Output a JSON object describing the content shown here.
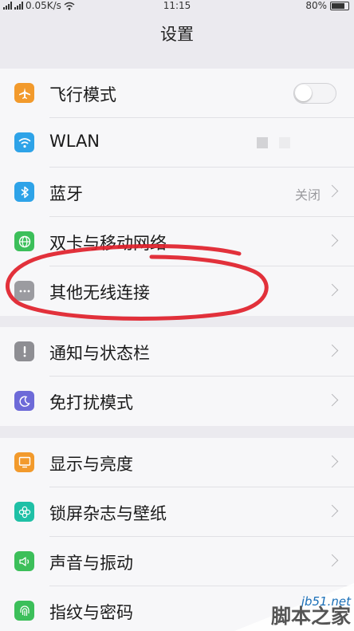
{
  "status_bar": {
    "network_speed": "0.05K/s",
    "time": "11:15",
    "battery": "80%",
    "battery_level": 0.8
  },
  "header": {
    "title": "设置"
  },
  "groups": [
    {
      "items": [
        {
          "label": "飞行模式",
          "icon": "airplane-icon",
          "color": "#f29a2c",
          "control": "toggle",
          "toggle_on": false
        },
        {
          "label": "WLAN",
          "icon": "wifi-icon",
          "color": "#2ea3e8",
          "control": "loading"
        },
        {
          "label": "蓝牙",
          "icon": "bluetooth-icon",
          "color": "#2ea3e8",
          "control": "chevron",
          "value": "关闭"
        },
        {
          "label": "双卡与移动网络",
          "icon": "globe-icon",
          "color": "#3cbf5a",
          "control": "chevron"
        },
        {
          "label": "其他无线连接",
          "icon": "more-dots-icon",
          "color": "#9b9ba0",
          "control": "chevron"
        }
      ]
    },
    {
      "items": [
        {
          "label": "通知与状态栏",
          "icon": "exclamation-icon",
          "color": "#8e8e93",
          "control": "chevron"
        },
        {
          "label": "免打扰模式",
          "icon": "moon-icon",
          "color": "#6d6ad8",
          "control": "chevron"
        }
      ]
    },
    {
      "items": [
        {
          "label": "显示与亮度",
          "icon": "display-icon",
          "color": "#f29a2c",
          "control": "chevron"
        },
        {
          "label": "锁屏杂志与壁纸",
          "icon": "flower-icon",
          "color": "#1fc0a6",
          "control": "chevron"
        },
        {
          "label": "声音与振动",
          "icon": "speaker-icon",
          "color": "#3cbf5a",
          "control": "chevron"
        },
        {
          "label": "指纹与密码",
          "icon": "fingerprint-icon",
          "color": "#3cbf5a",
          "control": "chevron"
        }
      ]
    }
  ],
  "watermark": {
    "url": "jb51.net",
    "text": "脚本之家"
  },
  "colors": {
    "annotation": "#e0202a",
    "background": "#ebeaef"
  }
}
